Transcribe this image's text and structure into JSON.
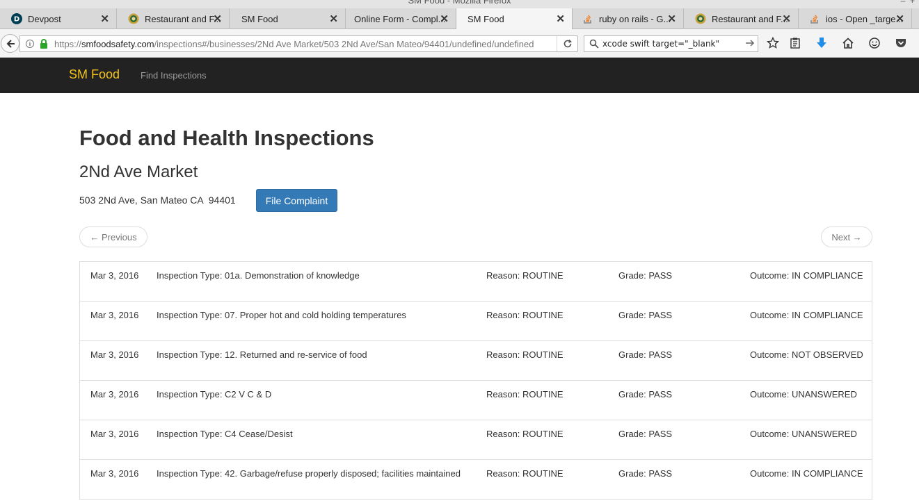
{
  "window": {
    "title": "SM Food - Mozilla Firefox"
  },
  "tabs": [
    {
      "label": "Devpost",
      "icon": "devpost-icon"
    },
    {
      "label": "Restaurant and F...",
      "icon": "seal-icon"
    },
    {
      "label": "SM Food",
      "icon": "none"
    },
    {
      "label": "Online Form - Compl...",
      "icon": "none"
    },
    {
      "label": "SM Food",
      "icon": "none",
      "active": true
    },
    {
      "label": "ruby on rails - G...",
      "icon": "stackoverflow-icon"
    },
    {
      "label": "Restaurant and F...",
      "icon": "seal-icon"
    },
    {
      "label": "ios - Open _targe...",
      "icon": "stackoverflow-icon"
    }
  ],
  "toolbar": {
    "url_scheme": "https://",
    "url_host": "smfoodsafety.com",
    "url_path": "/inspections#/businesses/2Nd Ave Market/503 2Nd Ave/San Mateo/94401/undefined/undefined",
    "search_value": "xcode swift target=\"_blank\""
  },
  "site": {
    "brand": "SM Food",
    "nav_link": "Find Inspections"
  },
  "page": {
    "title": "Food and Health Inspections",
    "business_name": "2Nd Ave Market",
    "address": "503 2Nd Ave, San Mateo CA  94401",
    "file_complaint_label": "File Complaint",
    "previous_label": "← Previous",
    "next_label": "Next →"
  },
  "inspections": [
    {
      "date": "Mar 3, 2016",
      "type": "Inspection Type: 01a. Demonstration of knowledge",
      "reason": "Reason: ROUTINE",
      "grade": "Grade: PASS",
      "outcome": "Outcome: IN COMPLIANCE"
    },
    {
      "date": "Mar 3, 2016",
      "type": "Inspection Type: 07. Proper hot and cold holding temperatures",
      "reason": "Reason: ROUTINE",
      "grade": "Grade: PASS",
      "outcome": "Outcome: IN COMPLIANCE"
    },
    {
      "date": "Mar 3, 2016",
      "type": "Inspection Type: 12. Returned and re-service of food",
      "reason": "Reason: ROUTINE",
      "grade": "Grade: PASS",
      "outcome": "Outcome: NOT OBSERVED"
    },
    {
      "date": "Mar 3, 2016",
      "type": "Inspection Type: C2 V C & D",
      "reason": "Reason: ROUTINE",
      "grade": "Grade: PASS",
      "outcome": "Outcome: UNANSWERED"
    },
    {
      "date": "Mar 3, 2016",
      "type": "Inspection Type: C4 Cease/Desist",
      "reason": "Reason: ROUTINE",
      "grade": "Grade: PASS",
      "outcome": "Outcome: UNANSWERED"
    },
    {
      "date": "Mar 3, 2016",
      "type": "Inspection Type: 42. Garbage/refuse properly disposed; facilities maintained",
      "reason": "Reason: ROUTINE",
      "grade": "Grade: PASS",
      "outcome": "Outcome: IN COMPLIANCE"
    }
  ],
  "colors": {
    "navbar_bg": "#222222",
    "brand": "#f5c518",
    "primary_button": "#337ab7"
  }
}
